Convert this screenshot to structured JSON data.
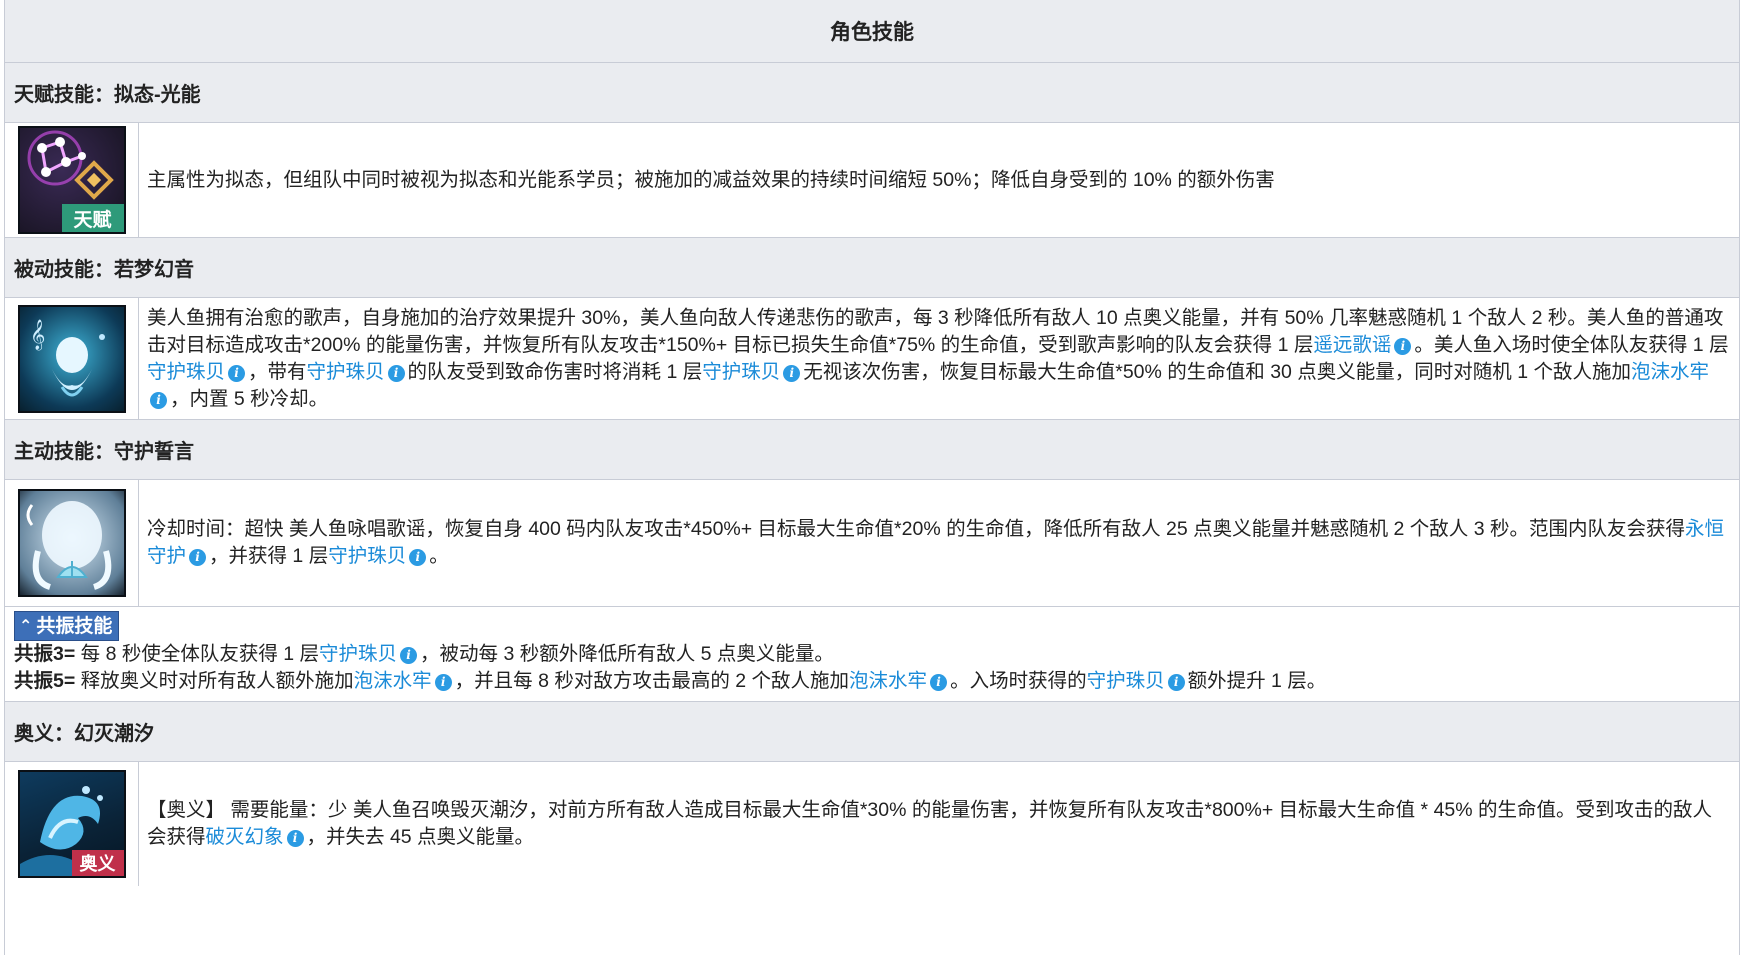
{
  "table_title": "角色技能",
  "talent": {
    "header": "天赋技能：拟态-光能",
    "icon_badge": "天赋",
    "description": "主属性为拟态，但组队中同时被视为拟态和光能系学员；被施加的减益效果的持续时间缩短 50%；降低自身受到的 10% 的额外伤害"
  },
  "passive": {
    "header": "被动技能：若梦幻音",
    "lines": [
      "美人鱼拥有治愈的歌声，自身施加的治疗效果提升 30%，美人鱼向敌人传递悲伤的歌声，每 3 秒降低所有敌人 10 点奥义能量，并有 50% 几率魅惑随机 1 个敌人 2 秒。美人鱼的普通攻击对目标造成攻击*200% 的能量伤害，并恢复所有队友攻击*150%+ 目标已损失生命值*75% 的生命值，受到歌声影响的队友会获得 1 层",
      "遥远歌谣",
      "。美人鱼入场时使全体队友获得 1 层",
      "守护珠贝",
      "，带有",
      "守护珠贝",
      "的队友受到致命伤害时将消耗 1 层",
      "守护珠贝",
      "无视该次伤害，恢复目标最大生命值*50% 的生命值和 30 点奥义能量，同时对随机 1 个敌人施加",
      "泡沫水牢",
      "，内置 5 秒冷却。"
    ]
  },
  "active": {
    "header": "主动技能：守护誓言",
    "parts": [
      "冷却时间：超快 美人鱼咏唱歌谣，恢复自身 400 码内队友攻击*450%+ 目标最大生命值*20% 的生命值，降低所有敌人 25 点奥义能量并魅惑随机 2 个敌人 3 秒。范围内队友会获得",
      "永恒守护",
      "，并获得 1 层",
      "守护珠贝",
      "。"
    ]
  },
  "resonance": {
    "badge": "共振技能",
    "r3_label": "共振3=",
    "r3_parts": [
      " 每 8 秒使全体队友获得 1 层",
      "守护珠贝",
      "，被动每 3 秒额外降低所有敌人 5 点奥义能量。"
    ],
    "r5_label": "共振5=",
    "r5_parts": [
      " 释放奥义时对所有敌人额外施加",
      "泡沫水牢",
      "，并且每 8 秒对敌方攻击最高的 2 个敌人施加",
      "泡沫水牢",
      "。入场时获得的",
      "守护珠贝",
      "额外提升 1 层。"
    ]
  },
  "ultimate": {
    "header": "奥义：幻灭潮汐",
    "icon_badge": "奥义",
    "parts": [
      "【奥义】 需要能量：少 美人鱼召唤毁灭潮汐，对前方所有敌人造成目标最大生命值*30% 的能量伤害，并恢复所有队友攻击*800%+ 目标最大生命值 * 45% 的生命值。受到攻击的敌人会获得",
      "破灭幻象",
      "，并失去 45 点奥义能量。"
    ]
  },
  "info_glyph": "i",
  "colors": {
    "header_bg": "#eaecf0",
    "link": "#1b8bd8",
    "badge": "#3d6fb8",
    "border": "#c8ccd6"
  }
}
